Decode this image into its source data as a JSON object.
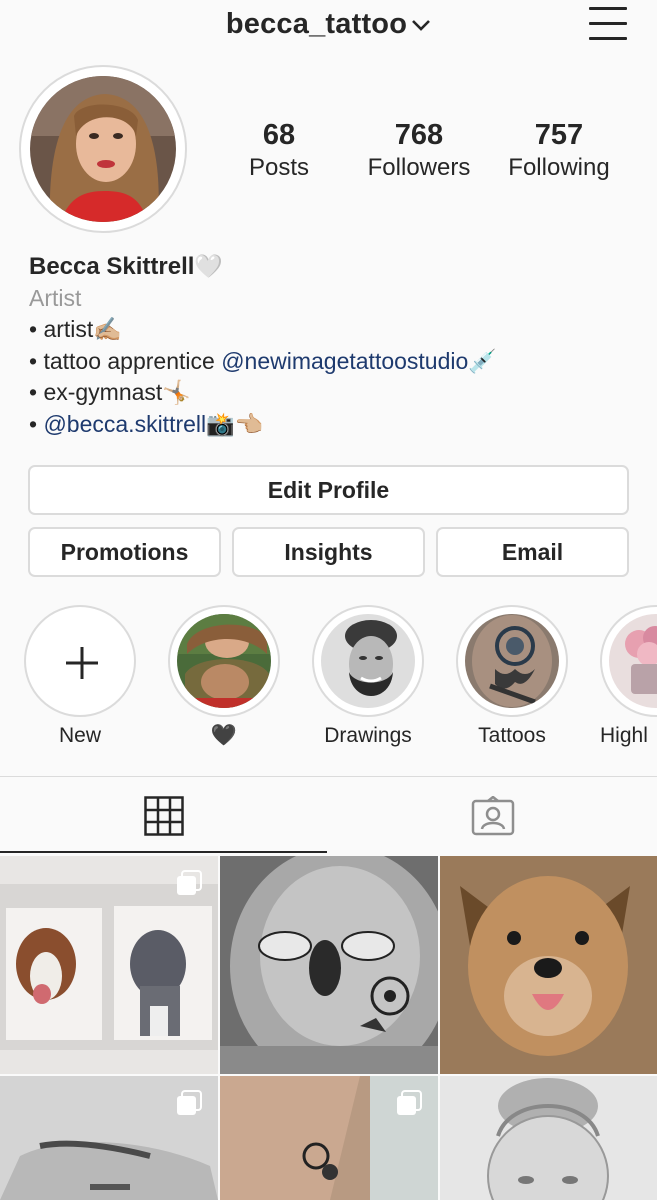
{
  "header": {
    "username": "becca_tattoo"
  },
  "stats": [
    {
      "value": "68",
      "label": "Posts"
    },
    {
      "value": "768",
      "label": "Followers"
    },
    {
      "value": "757",
      "label": "Following"
    }
  ],
  "bio": {
    "name": "Becca Skittrell",
    "name_emoji": "🤍",
    "category": "Artist",
    "line1_text": "• artist",
    "line1_emoji": "✍🏼",
    "line2_text": "• tattoo apprentice ",
    "line2_mention": "@newimagetattoostudio",
    "line2_emoji": "💉",
    "line3_text": "• ex-gymnast",
    "line3_emoji": "🤸🏼",
    "line4_text": "• ",
    "line4_mention": "@becca.skittrell",
    "line4_emoji": "📸👈🏼"
  },
  "buttons": {
    "edit_profile": "Edit Profile",
    "promotions": "Promotions",
    "insights": "Insights",
    "email": "Email"
  },
  "highlights": [
    {
      "label": "New"
    },
    {
      "label": "🖤"
    },
    {
      "label": "Drawings"
    },
    {
      "label": "Tattoos"
    },
    {
      "label": "Highl"
    }
  ],
  "tabs": {
    "grid_icon": "grid-icon",
    "tagged_icon": "tagged-icon"
  },
  "colors": {
    "accent_link": "#1e3a6e",
    "border": "#dbdbdb",
    "text": "#262626",
    "muted": "#999999"
  }
}
